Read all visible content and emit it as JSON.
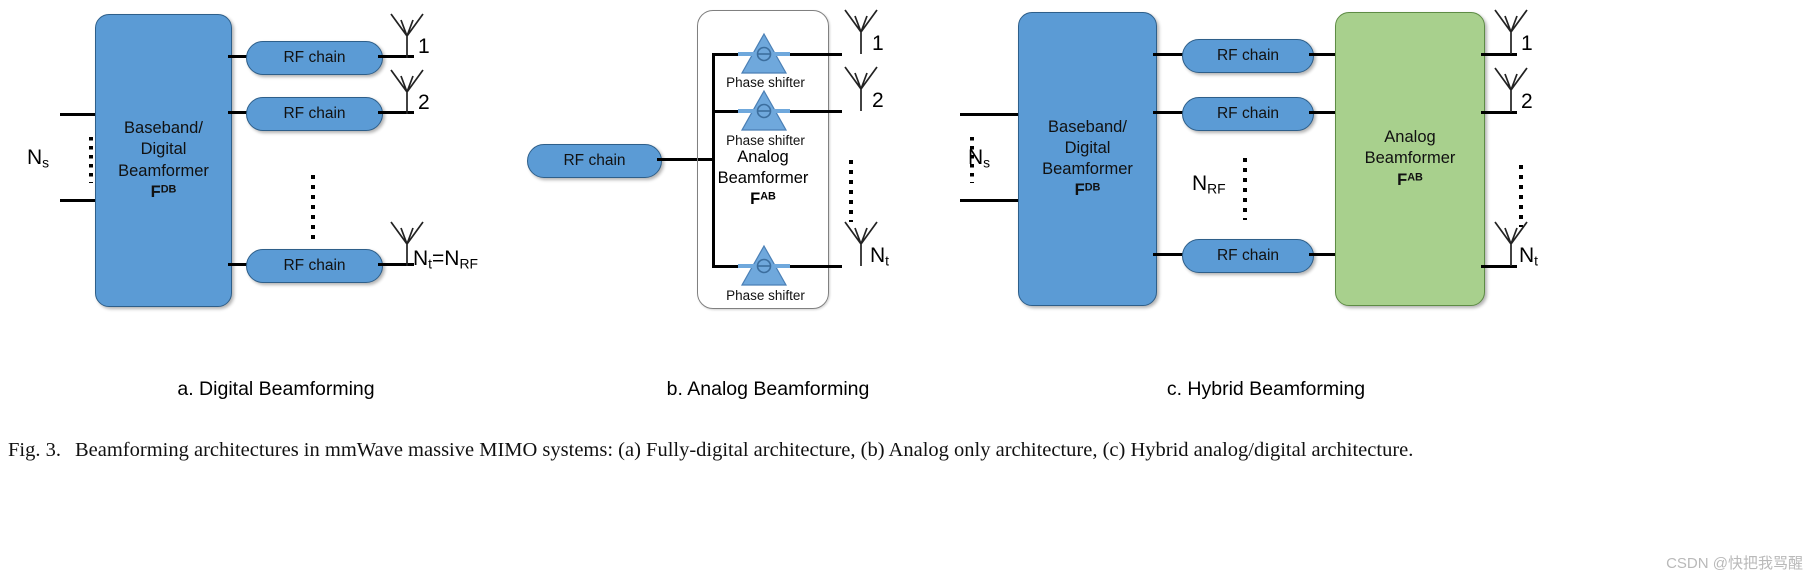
{
  "figure": {
    "caption_number": "Fig. 3.",
    "caption_text": "Beamforming architectures in mmWave massive MIMO systems: (a) Fully-digital architecture, (b) Analog only architecture, (c) Hybrid analog/digital architecture.",
    "watermark": "CSDN @快把我骂醒"
  },
  "colors": {
    "block_blue": "#5B9BD5",
    "block_green": "#A8D08D",
    "wire_black": "#000000",
    "frame_gray": "#808080"
  },
  "panels": [
    {
      "id": "digital",
      "caption": "a. Digital Beamforming",
      "input_label": "N",
      "input_sub": "s",
      "block": {
        "line1": "Baseband/",
        "line2": "Digital",
        "line3": "Beamformer",
        "symbol": "F",
        "symbol_sup": "DB"
      },
      "rf_chains": [
        "RF chain",
        "RF chain",
        "RF chain"
      ],
      "antennas": [
        {
          "label": "1",
          "sub": ""
        },
        {
          "label": "2",
          "sub": ""
        },
        {
          "label": "N",
          "sub": "t",
          "label2": "=N",
          "sub2": "RF"
        }
      ]
    },
    {
      "id": "analog",
      "caption": "b. Analog Beamforming",
      "rf_chain": "RF chain",
      "block": {
        "line1": "Analog",
        "line2": "Beamformer",
        "symbol": "F",
        "symbol_sup": "AB"
      },
      "phase_shifters": [
        "Phase shifter",
        "Phase shifter",
        "Phase shifter"
      ],
      "antennas": [
        {
          "label": "1",
          "sub": ""
        },
        {
          "label": "2",
          "sub": ""
        },
        {
          "label": "N",
          "sub": "t"
        }
      ]
    },
    {
      "id": "hybrid",
      "caption": "c. Hybrid Beamforming",
      "input_label": "N",
      "input_sub": "s",
      "digital_block": {
        "line1": "Baseband/",
        "line2": "Digital",
        "line3": "Beamformer",
        "symbol": "F",
        "symbol_sup": "DB"
      },
      "analog_block": {
        "line1": "Analog",
        "line2": "Beamformer",
        "symbol": "F",
        "symbol_sup": "AB"
      },
      "rf_chains": [
        "RF chain",
        "RF chain",
        "RF chain"
      ],
      "nrf_label": "N",
      "nrf_sub": "RF",
      "antennas": [
        {
          "label": "1",
          "sub": ""
        },
        {
          "label": "2",
          "sub": ""
        },
        {
          "label": "N",
          "sub": "t"
        }
      ]
    }
  ]
}
